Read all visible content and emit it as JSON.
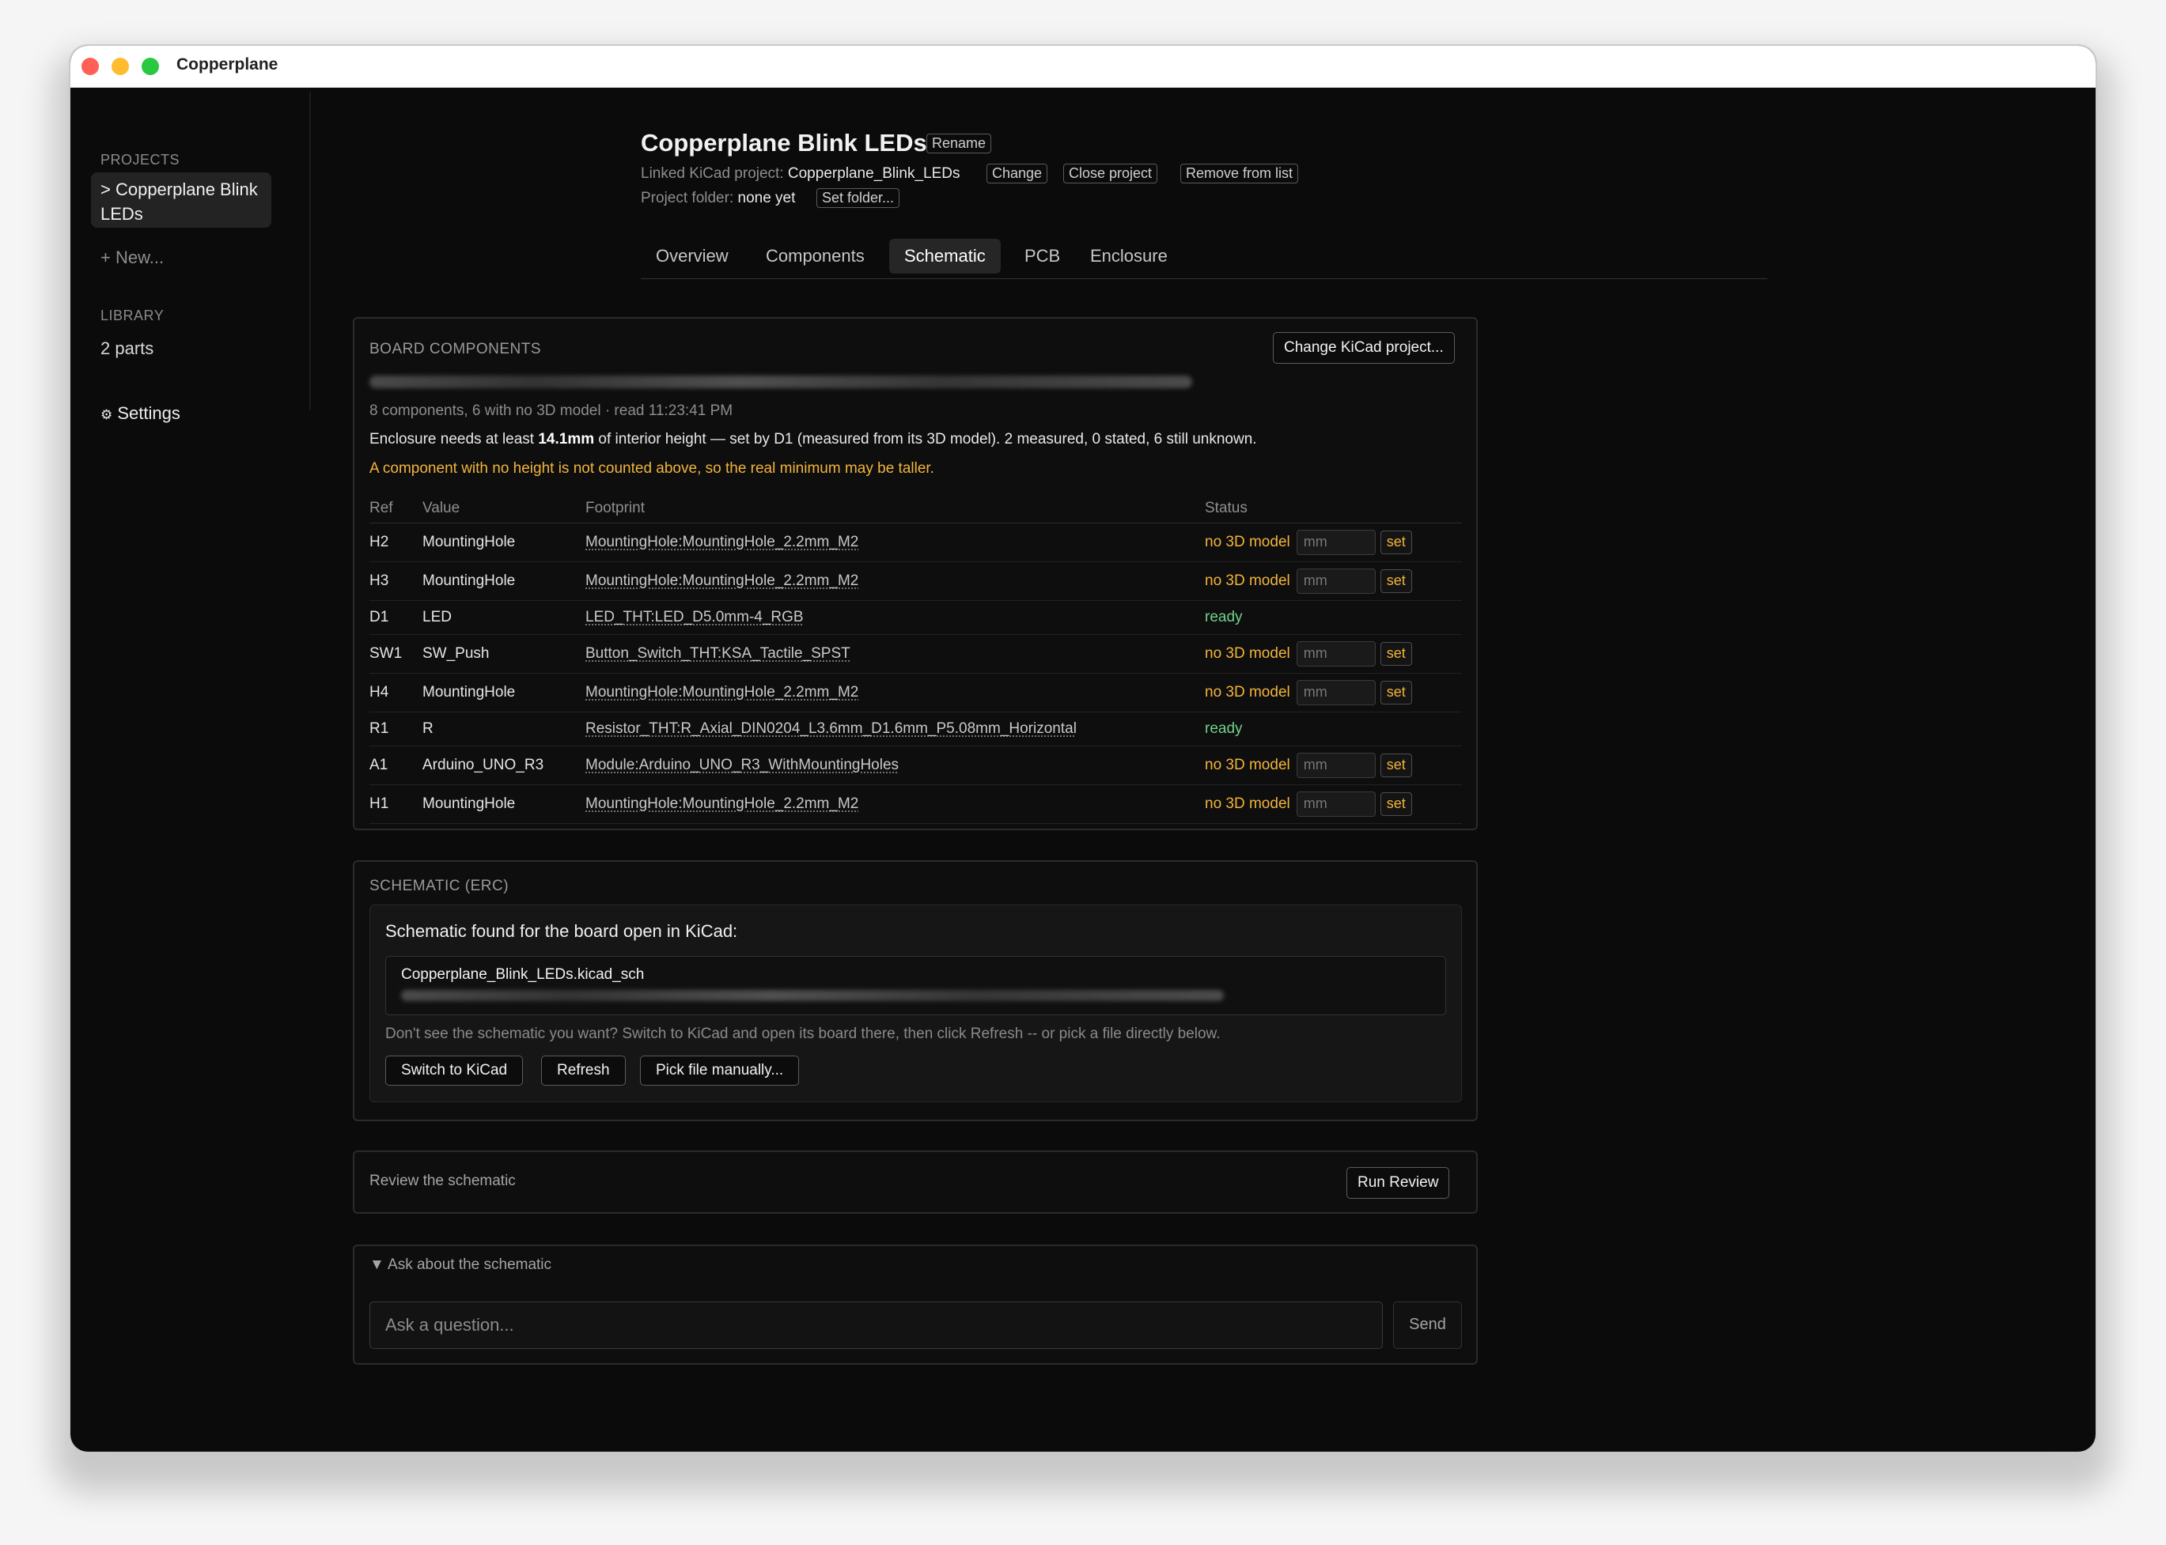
{
  "window": {
    "title": "Copperplane"
  },
  "sidebar": {
    "projects_heading": "PROJECTS",
    "active_project": "> Copperplane Blink LEDs",
    "new_label": "+ New...",
    "library_heading": "LIBRARY",
    "library_count": "2 parts",
    "settings_icon": "gear-icon",
    "settings_glyph": "⚙",
    "settings_label": "Settings"
  },
  "header": {
    "title": "Copperplane Blink LEDs",
    "rename": "Rename",
    "linked_label": "Linked KiCad project:",
    "linked_value": "Copperplane_Blink_LEDs",
    "change": "Change",
    "close_project": "Close project",
    "remove": "Remove from list",
    "folder_label": "Project folder:",
    "folder_value": "none yet",
    "set_folder": "Set folder..."
  },
  "tabs": [
    "Overview",
    "Components",
    "Schematic",
    "PCB",
    "Enclosure"
  ],
  "active_tab": "Schematic",
  "board": {
    "heading": "BOARD COMPONENTS",
    "change_btn": "Change KiCad project...",
    "summary": "8 components, 6 with no 3D model · read 11:23:41 PM",
    "enclosure_prefix": "Enclosure needs at least ",
    "enclosure_value": "14.1mm",
    "enclosure_suffix": " of interior height — set by D1 (measured from its 3D model). 2 measured, 0 stated, 6 still unknown.",
    "warning": "A component with no height is not counted above, so the real minimum may be taller.",
    "columns": {
      "ref": "Ref",
      "value": "Value",
      "footprint": "Footprint",
      "status": "Status"
    },
    "input_placeholder": "mm",
    "set_label": "set",
    "rows": [
      {
        "ref": "H2",
        "value": "MountingHole",
        "footprint": "MountingHole:MountingHole_2.2mm_M2",
        "status": "no 3D model",
        "ok": false
      },
      {
        "ref": "H3",
        "value": "MountingHole",
        "footprint": "MountingHole:MountingHole_2.2mm_M2",
        "status": "no 3D model",
        "ok": false
      },
      {
        "ref": "D1",
        "value": "LED",
        "footprint": "LED_THT:LED_D5.0mm-4_RGB",
        "status": "ready",
        "ok": true
      },
      {
        "ref": "SW1",
        "value": "SW_Push",
        "footprint": "Button_Switch_THT:KSA_Tactile_SPST",
        "status": "no 3D model",
        "ok": false
      },
      {
        "ref": "H4",
        "value": "MountingHole",
        "footprint": "MountingHole:MountingHole_2.2mm_M2",
        "status": "no 3D model",
        "ok": false
      },
      {
        "ref": "R1",
        "value": "R",
        "footprint": "Resistor_THT:R_Axial_DIN0204_L3.6mm_D1.6mm_P5.08mm_Horizontal",
        "status": "ready",
        "ok": true
      },
      {
        "ref": "A1",
        "value": "Arduino_UNO_R3",
        "footprint": "Module:Arduino_UNO_R3_WithMountingHoles",
        "status": "no 3D model",
        "ok": false
      },
      {
        "ref": "H1",
        "value": "MountingHole",
        "footprint": "MountingHole:MountingHole_2.2mm_M2",
        "status": "no 3D model",
        "ok": false
      }
    ]
  },
  "schematic": {
    "heading": "SCHEMATIC (ERC)",
    "found": "Schematic found for the board open in KiCad:",
    "file_name": "Copperplane_Blink_LEDs.kicad_sch",
    "hint": "Don't see the schematic you want? Switch to KiCad and open its board there, then click Refresh -- or pick a file directly below.",
    "switch_btn": "Switch to KiCad",
    "refresh_btn": "Refresh",
    "pick_btn": "Pick file manually..."
  },
  "review": {
    "label": "Review the schematic",
    "button": "Run Review"
  },
  "ask": {
    "toggle": "▼ Ask about the schematic",
    "placeholder": "Ask a question...",
    "send": "Send"
  },
  "colors": {
    "accent_warn": "#f2b43c",
    "accent_ok": "#6fd28a",
    "background": "#0b0b0b"
  }
}
